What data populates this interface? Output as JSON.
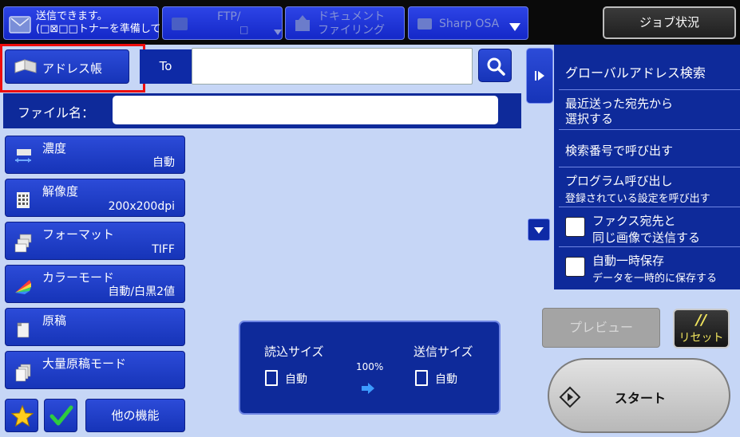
{
  "topbar": {
    "message_line1": "送信できます。",
    "message_line2": "(□⊠□□トナーを準備してください。)",
    "tabs": [
      {
        "line1": "FTP/",
        "line2": "□"
      },
      {
        "line1": "ドキュメント",
        "line2": "ファイリング"
      },
      {
        "label": "Sharp OSA"
      }
    ],
    "job_status": "ジョブ状況"
  },
  "address": {
    "book_label": "アドレス帳",
    "to_label": "To",
    "to_value": ""
  },
  "file": {
    "label": "ファイル名：",
    "value": ""
  },
  "functions": [
    {
      "title": "濃度",
      "value": "自動",
      "icon": "density-icon"
    },
    {
      "title": "解像度",
      "value": "200x200dpi",
      "icon": "resolution-icon"
    },
    {
      "title": "フォーマット",
      "value": "TIFF",
      "icon": "format-icon"
    },
    {
      "title": "カラーモード",
      "value": "自動/白黒2値",
      "icon": "color-mode-icon"
    },
    {
      "title": "原稿",
      "value": "",
      "icon": "original-icon"
    },
    {
      "title": "大量原稿モード",
      "value": "",
      "icon": "job-build-icon"
    }
  ],
  "bottom_left": {
    "other_functions": "他の機能"
  },
  "size_panel": {
    "scan_label": "読込サイズ",
    "scan_value": "自動",
    "ratio": "100%",
    "send_label": "送信サイズ",
    "send_value": "自動"
  },
  "right_panel": {
    "global_search": "グローバルアドレス検索",
    "recent_line1": "最近送った宛先から",
    "recent_line2": "選択する",
    "search_number": "検索番号で呼び出す",
    "program_main": "プログラム呼び出し",
    "program_sub": "登録されている設定を呼び出す",
    "fax_line1": "ファクス宛先と",
    "fax_line2": "同じ画像で送信する",
    "store_main": "自動一時保存",
    "store_sub": "データを一時的に保存する"
  },
  "actions": {
    "preview": "プレビュー",
    "reset_symbol": "//",
    "reset": "リセット",
    "start": "スタート"
  },
  "colors": {
    "background": "#c6d6f6",
    "panel": "#0e2a9a",
    "button": "#1634b8",
    "highlight": "#ee0d0d",
    "reset_text": "#f1e55e"
  }
}
